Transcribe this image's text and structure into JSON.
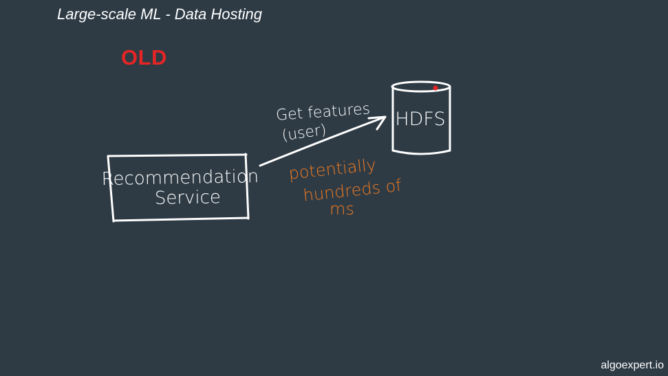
{
  "title": "Large-scale ML - Data Hosting",
  "label": "OLD",
  "label_color": "#e52525",
  "diagram": {
    "service_box": {
      "line1": "Recommendation",
      "line2": "Service"
    },
    "storage": {
      "label": "HDFS"
    },
    "arrow_label": {
      "line1": "Get features",
      "line2": "(user)"
    },
    "latency_note": {
      "line1": "potentially",
      "line2": "hundreds of",
      "line3": "ms",
      "color": "#f07a20"
    }
  },
  "watermark": "algoexpert.io"
}
